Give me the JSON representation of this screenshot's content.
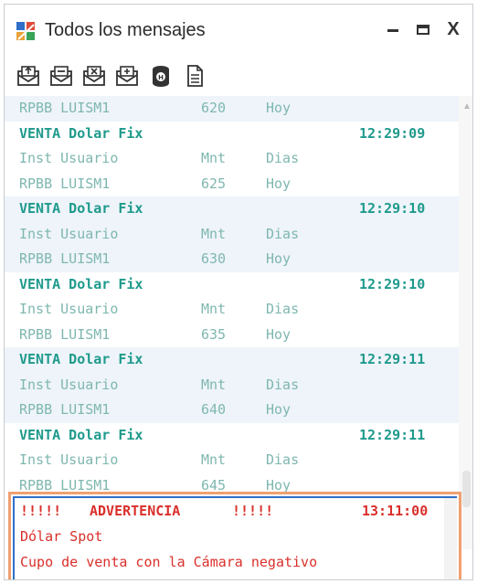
{
  "window": {
    "title": "Todos los mensajes",
    "controls": {
      "minimize": "–",
      "maximize": "□",
      "close": "X"
    }
  },
  "toolbar": {
    "icons": [
      "envelope-up-icon",
      "envelope-minus-icon",
      "envelope-x-icon",
      "envelope-plus-icon",
      "database-icon",
      "document-icon"
    ]
  },
  "messages": {
    "top_partial": {
      "inst_user": "RPBB LUISM1",
      "mnt": "620",
      "dias": "Hoy"
    },
    "items": [
      {
        "title": "VENTA Dolar Fix",
        "time": "12:29:09",
        "col1": "Inst Usuario",
        "col2": "Mnt",
        "col3": "Dias",
        "inst_user": "RPBB LUISM1",
        "mnt": "625",
        "dias": "Hoy"
      },
      {
        "title": "VENTA Dolar Fix",
        "time": "12:29:10",
        "col1": "Inst Usuario",
        "col2": "Mnt",
        "col3": "Dias",
        "inst_user": "RPBB LUISM1",
        "mnt": "630",
        "dias": "Hoy"
      },
      {
        "title": "VENTA Dolar Fix",
        "time": "12:29:10",
        "col1": "Inst Usuario",
        "col2": "Mnt",
        "col3": "Dias",
        "inst_user": "RPBB LUISM1",
        "mnt": "635",
        "dias": "Hoy"
      },
      {
        "title": "VENTA Dolar Fix",
        "time": "12:29:11",
        "col1": "Inst Usuario",
        "col2": "Mnt",
        "col3": "Dias",
        "inst_user": "RPBB LUISM1",
        "mnt": "640",
        "dias": "Hoy"
      },
      {
        "title": "VENTA Dolar Fix",
        "time": "12:29:11",
        "col1": "Inst Usuario",
        "col2": "Mnt",
        "col3": "Dias",
        "inst_user": "RPBB LUISM1",
        "mnt": "645",
        "dias": "Hoy"
      }
    ]
  },
  "alert": {
    "bang_left": "!!!!!",
    "title": "ADVERTENCIA",
    "bang_right": "!!!!!",
    "time": "13:11:00",
    "line1": "Dólar Spot",
    "line2": "Cupo de venta con la Cámara negativo"
  },
  "colors": {
    "header_teal": "#1f9a8c",
    "label_teal": "#7fb7b0",
    "alert_red": "#d9302b",
    "highlight_orange": "#f0a070",
    "alert_border_blue": "#2f6fc8",
    "alt_row_bg": "#eef4fa"
  }
}
